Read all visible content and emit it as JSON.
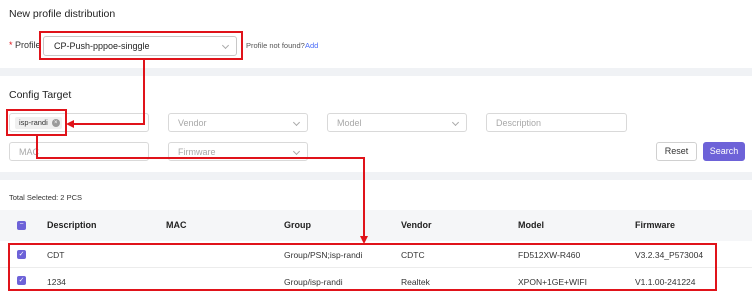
{
  "section1": {
    "title": "New profile distribution",
    "profile_required": "*",
    "profile_label": "Profile",
    "profile_value": "CP-Push-pppoe-singgle",
    "not_found_text": "Profile not found?",
    "add_link": "Add"
  },
  "section2": {
    "title": "Config Target",
    "tag_label": "isp-randi",
    "vendor_placeholder": "Vendor",
    "model_placeholder": "Model",
    "description_placeholder": "Description",
    "mac_placeholder": "MAC",
    "firmware_placeholder": "Firmware",
    "reset_label": "Reset",
    "search_label": "Search"
  },
  "results": {
    "total_label": "Total Selected:",
    "total_count": "2",
    "total_unit": "PCS",
    "columns": [
      "Description",
      "MAC",
      "Group",
      "Vendor",
      "Model",
      "Firmware"
    ],
    "rows": [
      {
        "description": "CDT",
        "mac": "",
        "group": "Group/PSN;isp-randi",
        "vendor": "CDTC",
        "model": "FD512XW-R460",
        "firmware": "V3.2.34_P573004"
      },
      {
        "description": "1234",
        "mac": "",
        "group": "Group/isp-randi",
        "vendor": "Realtek",
        "model": "XPON+1GE+WIFI",
        "firmware": "V1.1.00-241224"
      }
    ]
  },
  "colors": {
    "accent": "#6d62d8",
    "highlight": "#e0131a",
    "link": "#4a6cf7"
  }
}
